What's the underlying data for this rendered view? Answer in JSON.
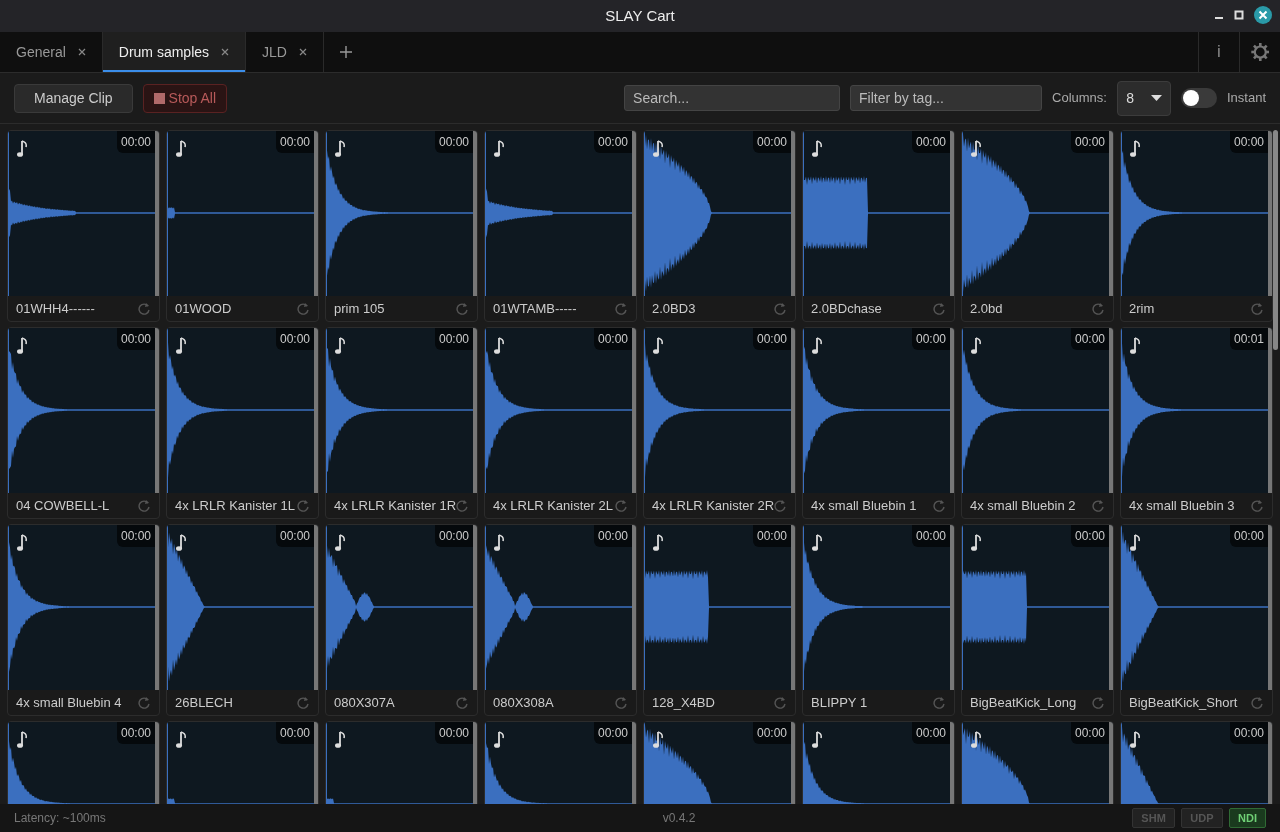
{
  "window": {
    "title": "SLAY Cart"
  },
  "tabs": [
    {
      "label": "General",
      "selected": false
    },
    {
      "label": "Drum samples",
      "selected": true
    },
    {
      "label": "JLD",
      "selected": false
    }
  ],
  "info_button": "i",
  "toolbar": {
    "manage_button": "Manage Clip",
    "stop_button": "Stop All",
    "search": {
      "placeholder": "Search..."
    },
    "tag_filter": {
      "placeholder": "Filter by tag..."
    },
    "columns_label": "Columns:",
    "columns_value": "8",
    "instant": {
      "label": "Instant",
      "on": false
    }
  },
  "clips": [
    {
      "name": "01WHH4------",
      "time": "00:00",
      "kind": "hat"
    },
    {
      "name": "01WOOD",
      "time": "00:00",
      "kind": "tick"
    },
    {
      "name": "prim 105",
      "time": "00:00",
      "kind": "spike"
    },
    {
      "name": "01WTAMB-----",
      "time": "00:00",
      "kind": "hat"
    },
    {
      "name": "2.0BD3",
      "time": "00:00",
      "kind": "kick"
    },
    {
      "name": "2.0BDchase",
      "time": "00:00",
      "kind": "block"
    },
    {
      "name": "2.0bd",
      "time": "00:00",
      "kind": "kick"
    },
    {
      "name": "2rim",
      "time": "00:00",
      "kind": "spike"
    },
    {
      "name": "04 COWBELL-L",
      "time": "00:00",
      "kind": "spike"
    },
    {
      "name": "4x LRLR Kanister 1L",
      "time": "00:00",
      "kind": "spike"
    },
    {
      "name": "4x LRLR Kanister 1R",
      "time": "00:00",
      "kind": "spike"
    },
    {
      "name": "4x LRLR Kanister 2L",
      "time": "00:00",
      "kind": "spike"
    },
    {
      "name": "4x LRLR Kanister 2R",
      "time": "00:00",
      "kind": "spike"
    },
    {
      "name": "4x small Bluebin 1",
      "time": "00:00",
      "kind": "spike"
    },
    {
      "name": "4x small Bluebin 2",
      "time": "00:00",
      "kind": "spike"
    },
    {
      "name": "4x small Bluebin 3",
      "time": "00:01",
      "kind": "spike"
    },
    {
      "name": "4x small Bluebin 4",
      "time": "00:00",
      "kind": "spike"
    },
    {
      "name": "26BLECH",
      "time": "00:00",
      "kind": "triangle"
    },
    {
      "name": "080X307A",
      "time": "00:00",
      "kind": "burst"
    },
    {
      "name": "080X308A",
      "time": "00:00",
      "kind": "burst"
    },
    {
      "name": "128_X4BD",
      "time": "00:00",
      "kind": "block"
    },
    {
      "name": "BLIPPY 1",
      "time": "00:00",
      "kind": "spike"
    },
    {
      "name": "BigBeatKick_Long",
      "time": "00:00",
      "kind": "block"
    },
    {
      "name": "BigBeatKick_Short",
      "time": "00:00",
      "kind": "triangle"
    },
    {
      "time": "00:00",
      "kind": "spike"
    },
    {
      "time": "00:00",
      "kind": "tick"
    },
    {
      "time": "00:00",
      "kind": "tick"
    },
    {
      "time": "00:00",
      "kind": "spike"
    },
    {
      "time": "00:00",
      "kind": "kick"
    },
    {
      "time": "00:00",
      "kind": "spike"
    },
    {
      "time": "00:00",
      "kind": "kick"
    },
    {
      "time": "00:00",
      "kind": "triangle"
    }
  ],
  "status_bar": {
    "latency": "Latency: ~100ms",
    "version": "v0.4.2",
    "outputs": [
      {
        "label": "SHM",
        "on": false
      },
      {
        "label": "UDP",
        "on": false
      },
      {
        "label": "NDI",
        "on": true
      }
    ]
  }
}
